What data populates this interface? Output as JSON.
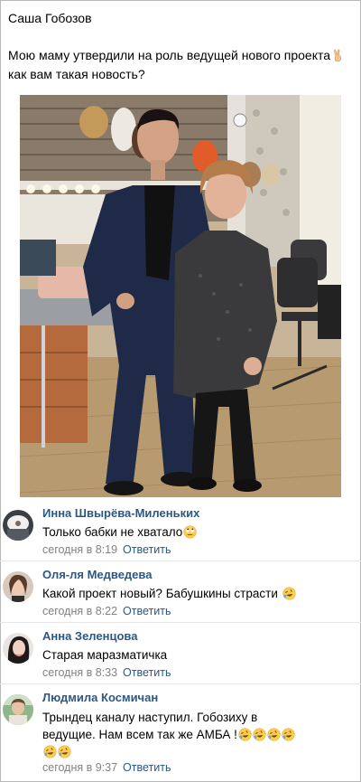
{
  "post": {
    "author": "Саша Гобозов",
    "text_line1": "Мою маму утвердили на роль ведущей нового проекта",
    "text_line2": "как вам такая новость?",
    "emoji": "victory-hand-icon"
  },
  "comments": [
    {
      "author": "Инна Швырёва-Миленьких",
      "text": "Только бабки не хватало",
      "emoji": "rolling-eyes-face-icon",
      "time": "сегодня в 8:19",
      "reply": "Ответить"
    },
    {
      "author": "Оля-ля Медведева",
      "text": "Какой проект новый? Бабушкины страсти",
      "emoji": "rolling-laughing-face-icon",
      "time": "сегодня в 8:22",
      "reply": "Ответить"
    },
    {
      "author": "Анна Зеленцова",
      "text": "Старая маразматичка",
      "time": "сегодня в 8:33",
      "reply": "Ответить"
    },
    {
      "author": "Людмила Космичан",
      "text_line1": "Трындец каналу наступил. Гобозиху в",
      "text_line2": "ведущие. Нам всем так же АМБА !",
      "emoji": "rolling-laughing-face-icon",
      "time": "сегодня в 9:37",
      "reply": "Ответить"
    }
  ],
  "colors": {
    "link": "#2a5885",
    "meta": "#828282",
    "divider": "#e3e6ea"
  }
}
